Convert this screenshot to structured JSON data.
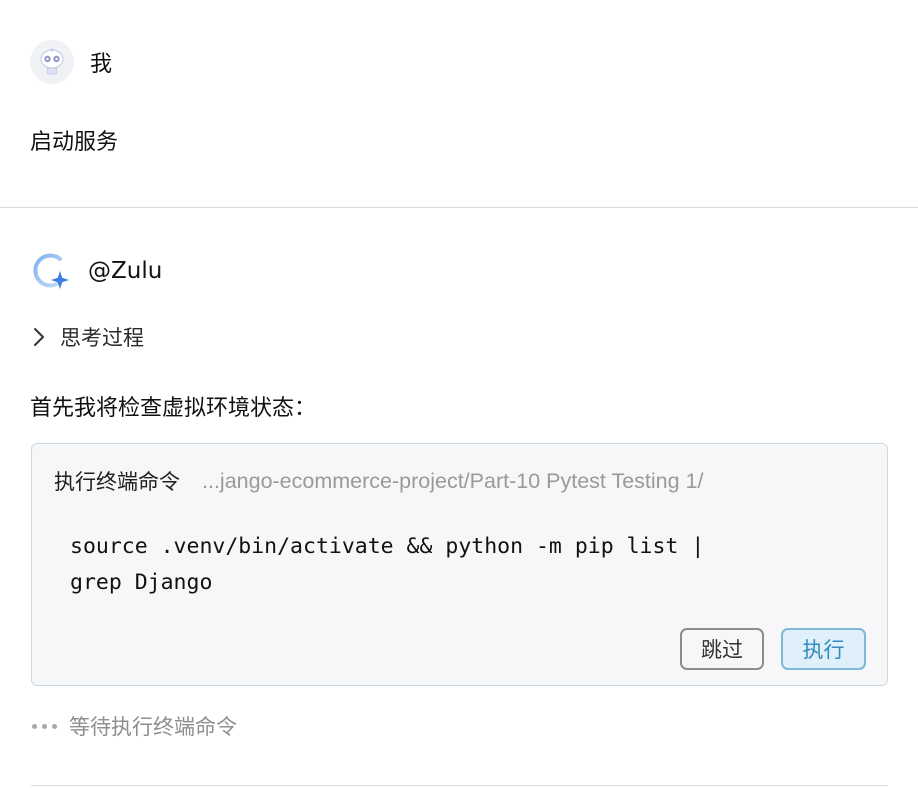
{
  "user": {
    "name": "我",
    "message": "启动服务",
    "avatar_icon": "robot-avatar-icon"
  },
  "assistant": {
    "name": "@Zulu",
    "avatar_icon": "zulu-logo-icon",
    "thinking_label": "思考过程",
    "intro_text": "首先我将检查虚拟环境状态："
  },
  "terminal": {
    "title": "执行终端命令",
    "path": "...jango-ecommerce-project/Part-10 Pytest Testing 1/",
    "command": "source .venv/bin/activate && python -m pip list |\ngrep Django",
    "skip_label": "跳过",
    "run_label": "执行"
  },
  "status": {
    "waiting_text": "等待执行终端命令"
  },
  "colors": {
    "accent": "#2f8bc0",
    "accent_bg": "#dff0fa",
    "card_border": "#c9d9e2",
    "card_bg": "#f7f7f9"
  }
}
